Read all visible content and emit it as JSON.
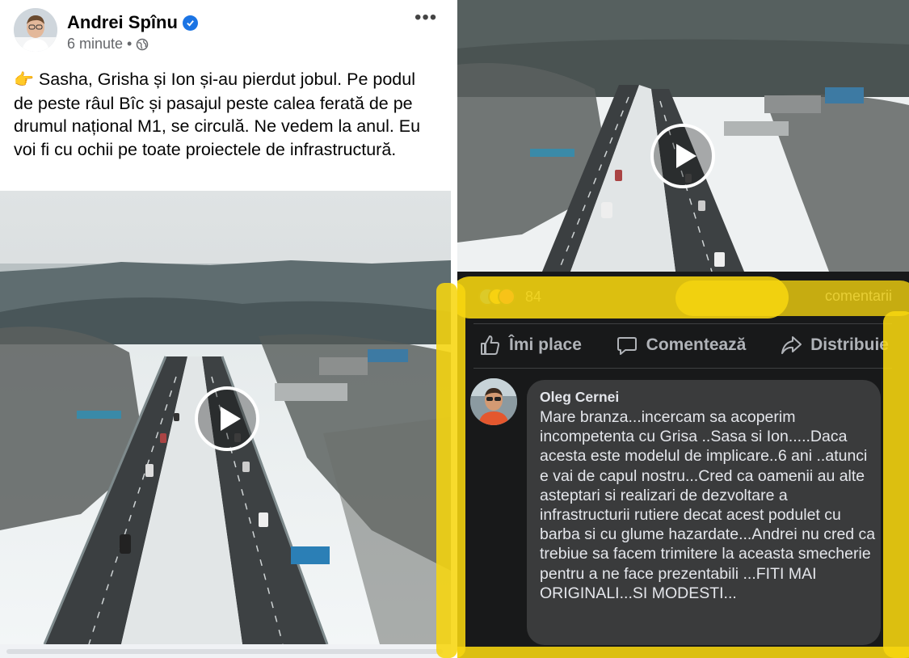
{
  "post": {
    "author": "Andrei Spînu",
    "time": "6 minute",
    "separator": "•",
    "emoji": "👉",
    "text": "Sasha, Grisha și Ion și-au pierdut jobul. Pe podul de peste râul Bîc și pasajul peste calea ferată de pe drumul național M1, se circulă. Ne vedem la anul. Eu voi fi cu ochii pe toate proiectele de infrastructură.",
    "more_label": "•••",
    "icons": {
      "verified": "verified-badge-icon",
      "audience": "globe-icon",
      "more": "more-options-icon",
      "play": "play-icon"
    }
  },
  "video_right": {
    "reactions_count": "84",
    "comments_label": "comentarii"
  },
  "actions": [
    {
      "label": "Îmi place",
      "icon": "thumbs-up-icon"
    },
    {
      "label": "Comentează",
      "icon": "comment-icon"
    },
    {
      "label": "Distribuie",
      "icon": "share-icon"
    }
  ],
  "comment": {
    "name": "Oleg Cernei",
    "text": "Mare branza...incercam sa acoperim incompetenta cu Grisa ..Sasa si Ion.....Daca acesta este modelul de implicare..6 ani ..atunci e vai de capul nostru...Cred ca oamenii au alte asteptari si realizari de dezvoltare a infrastructurii rutiere decat acest podulet cu barba si cu glume hazardate...Andrei nu cred ca trebiue sa facem trimitere la aceasta smecherie pentru a ne face prezentabili ...FITI MAI ORIGINALI...SI MODESTI..."
  },
  "colors": {
    "facebook_blue": "#1b74e4",
    "dark_bg": "#18191a",
    "bubble": "#3a3b3c",
    "highlight_yellow": "#f7d60f"
  }
}
